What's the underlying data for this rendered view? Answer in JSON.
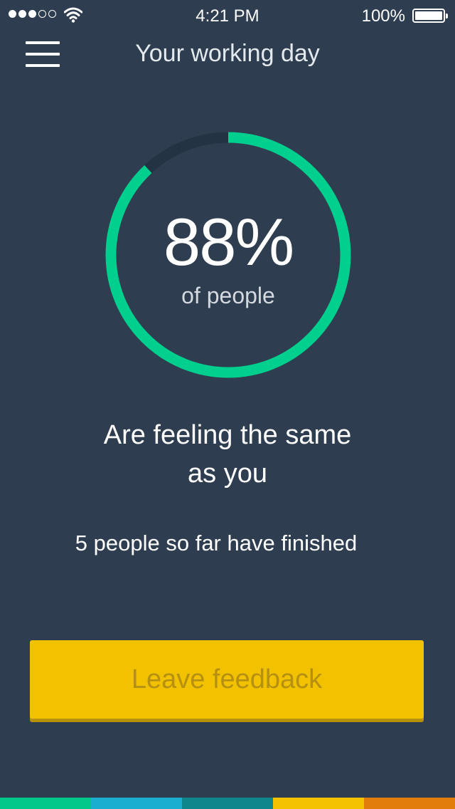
{
  "status_bar": {
    "time": "4:21 PM",
    "battery": "100%",
    "signal_bars_filled": 3,
    "signal_bars_total": 5
  },
  "header": {
    "menu_icon": "hamburger-menu-icon",
    "title": "Your working day"
  },
  "progress": {
    "value_percent": 88,
    "label": "88%",
    "sub_label": "of people",
    "colors": {
      "filled": "#00cf8e",
      "track": "#243344"
    }
  },
  "headline": {
    "line1": "Are feeling the same",
    "line2": "as you"
  },
  "finished_text": "5 people so far have finished",
  "feedback_button": {
    "label": "Leave feedback",
    "color": "#f2c100"
  },
  "color_bar": [
    "#00c98a",
    "#1aaed1",
    "#0f878a",
    "#f2c100",
    "#e17b0a"
  ],
  "colors": {
    "background": "#2e3d50"
  }
}
